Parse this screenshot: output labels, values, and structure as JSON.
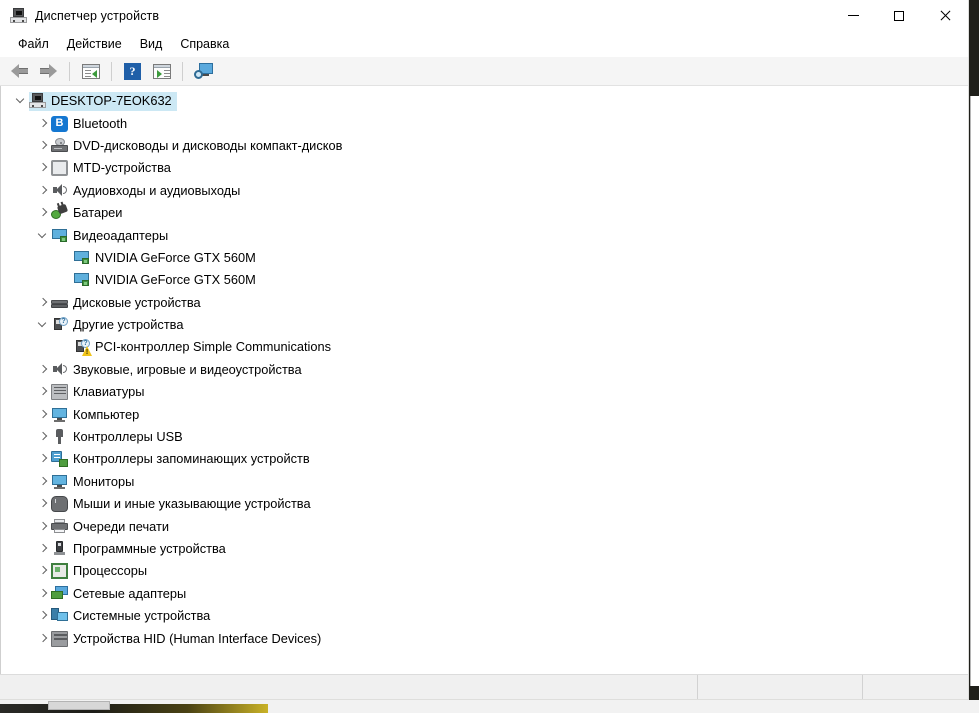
{
  "window": {
    "title": "Диспетчер устройств",
    "title_icon": "device-manager-icon",
    "controls": {
      "minimize": "—",
      "maximize": "☐",
      "close": "✕"
    }
  },
  "menubar": {
    "items": [
      {
        "label": "Файл",
        "name": "menu-file"
      },
      {
        "label": "Действие",
        "name": "menu-action"
      },
      {
        "label": "Вид",
        "name": "menu-view"
      },
      {
        "label": "Справка",
        "name": "menu-help"
      }
    ]
  },
  "toolbar": {
    "buttons": [
      {
        "name": "back-button",
        "icon": "arrow-left-icon",
        "tooltip": "Назад"
      },
      {
        "name": "forward-button",
        "icon": "arrow-right-icon",
        "tooltip": "Вперед"
      },
      {
        "name": "properties-button",
        "icon": "properties-panel-icon",
        "tooltip": "Свойства"
      },
      {
        "name": "help-button",
        "icon": "help-question-icon",
        "tooltip": "Справка"
      },
      {
        "name": "show-hide-pane-button",
        "icon": "show-pane-icon",
        "tooltip": "Показать/скрыть панель"
      },
      {
        "name": "scan-hardware-button",
        "icon": "scan-monitor-icon",
        "tooltip": "Обновить конфигурацию оборудования"
      }
    ]
  },
  "tree": {
    "selected": "DESKTOP-7EOK632",
    "nodes": [
      {
        "label": "DESKTOP-7EOK632",
        "icon": "computer-root-icon",
        "depth": 0,
        "expander": "open",
        "selected": true
      },
      {
        "label": "Bluetooth",
        "icon": "bluetooth-icon",
        "depth": 1,
        "expander": "collapsed"
      },
      {
        "label": "DVD-дисководы и дисководы компакт-дисков",
        "icon": "dvd-drive-icon",
        "depth": 1,
        "expander": "collapsed"
      },
      {
        "label": "MTD-устройства",
        "icon": "mtd-device-icon",
        "depth": 1,
        "expander": "collapsed"
      },
      {
        "label": "Аудиовходы и аудиовыходы",
        "icon": "audio-icon",
        "depth": 1,
        "expander": "collapsed"
      },
      {
        "label": "Батареи",
        "icon": "battery-icon",
        "depth": 1,
        "expander": "collapsed"
      },
      {
        "label": "Видеоадаптеры",
        "icon": "display-adapter-icon",
        "depth": 1,
        "expander": "open"
      },
      {
        "label": "NVIDIA GeForce GTX 560M",
        "icon": "display-adapter-icon",
        "depth": 2,
        "expander": "none"
      },
      {
        "label": "NVIDIA GeForce GTX 560M",
        "icon": "display-adapter-icon",
        "depth": 2,
        "expander": "none"
      },
      {
        "label": "Дисковые устройства",
        "icon": "disk-drive-icon",
        "depth": 1,
        "expander": "collapsed"
      },
      {
        "label": "Другие устройства",
        "icon": "other-device-icon",
        "depth": 1,
        "expander": "open"
      },
      {
        "label": "PCI-контроллер Simple Communications",
        "icon": "other-device-warning-icon",
        "depth": 2,
        "expander": "none",
        "warning": true
      },
      {
        "label": "Звуковые, игровые и видеоустройства",
        "icon": "audio-icon",
        "depth": 1,
        "expander": "collapsed"
      },
      {
        "label": "Клавиатуры",
        "icon": "keyboard-icon",
        "depth": 1,
        "expander": "collapsed"
      },
      {
        "label": "Компьютер",
        "icon": "monitor-icon",
        "depth": 1,
        "expander": "collapsed"
      },
      {
        "label": "Контроллеры USB",
        "icon": "usb-icon",
        "depth": 1,
        "expander": "collapsed"
      },
      {
        "label": "Контроллеры запоминающих устройств",
        "icon": "storage-controller-icon",
        "depth": 1,
        "expander": "collapsed"
      },
      {
        "label": "Мониторы",
        "icon": "monitor-icon",
        "depth": 1,
        "expander": "collapsed"
      },
      {
        "label": "Мыши и иные указывающие устройства",
        "icon": "mouse-icon",
        "depth": 1,
        "expander": "collapsed"
      },
      {
        "label": "Очереди печати",
        "icon": "printer-icon",
        "depth": 1,
        "expander": "collapsed"
      },
      {
        "label": "Программные устройства",
        "icon": "software-device-icon",
        "depth": 1,
        "expander": "collapsed"
      },
      {
        "label": "Процессоры",
        "icon": "cpu-icon",
        "depth": 1,
        "expander": "collapsed"
      },
      {
        "label": "Сетевые адаптеры",
        "icon": "network-adapter-icon",
        "depth": 1,
        "expander": "collapsed"
      },
      {
        "label": "Системные устройства",
        "icon": "system-device-icon",
        "depth": 1,
        "expander": "collapsed"
      },
      {
        "label": "Устройства HID (Human Interface Devices)",
        "icon": "hid-device-icon",
        "depth": 1,
        "expander": "collapsed"
      }
    ]
  },
  "statusbar": {
    "pane1": "",
    "pane2": "",
    "pane3": ""
  },
  "colors": {
    "selection": "#cce8f4",
    "accent_blue": "#1f5fa8",
    "warning_yellow": "#f0c419",
    "toolbar_bg": "#f5f5f5",
    "statusbar_bg": "#f0f0f0"
  }
}
